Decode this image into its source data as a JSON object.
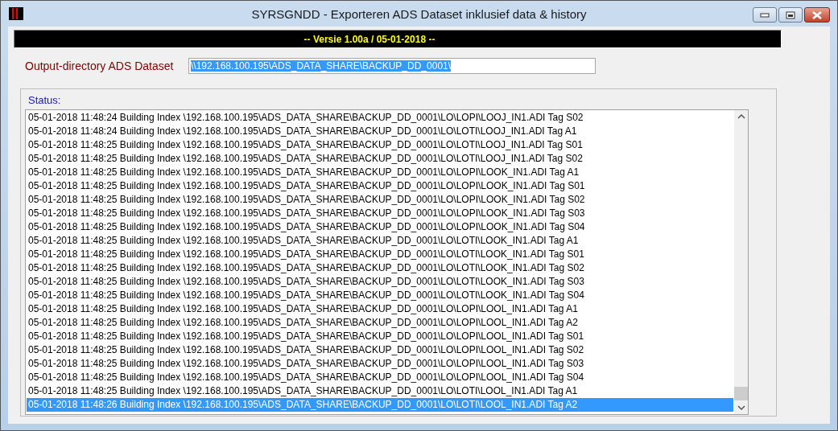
{
  "window": {
    "title": "SYRSGNDD - Exporteren ADS Dataset inklusief data & history"
  },
  "banner": {
    "text": "-- Versie 1.00a / 05-01-2018 --"
  },
  "output_directory": {
    "label": "Output-directory ADS Dataset",
    "value": "\\\\192.168.100.195\\ADS_DATA_SHARE\\BACKUP_DD_0001\\",
    "selected": true
  },
  "status": {
    "label": "Status:",
    "rows": [
      {
        "text": "05-01-2018 11:48:24 Building Index \\192.168.100.195\\ADS_DATA_SHARE\\BACKUP_DD_0001\\LO\\LOPI\\LOOJ_IN1.ADI Tag S02",
        "selected": false
      },
      {
        "text": "05-01-2018 11:48:24 Building Index \\192.168.100.195\\ADS_DATA_SHARE\\BACKUP_DD_0001\\LO\\LOTI\\LOOJ_IN1.ADI Tag A1",
        "selected": false
      },
      {
        "text": "05-01-2018 11:48:25 Building Index \\192.168.100.195\\ADS_DATA_SHARE\\BACKUP_DD_0001\\LO\\LOTI\\LOOJ_IN1.ADI Tag S01",
        "selected": false
      },
      {
        "text": "05-01-2018 11:48:25 Building Index \\192.168.100.195\\ADS_DATA_SHARE\\BACKUP_DD_0001\\LO\\LOTI\\LOOJ_IN1.ADI Tag S02",
        "selected": false
      },
      {
        "text": "05-01-2018 11:48:25 Building Index \\192.168.100.195\\ADS_DATA_SHARE\\BACKUP_DD_0001\\LO\\LOPI\\LOOK_IN1.ADI Tag A1",
        "selected": false
      },
      {
        "text": "05-01-2018 11:48:25 Building Index \\192.168.100.195\\ADS_DATA_SHARE\\BACKUP_DD_0001\\LO\\LOPI\\LOOK_IN1.ADI Tag S01",
        "selected": false
      },
      {
        "text": "05-01-2018 11:48:25 Building Index \\192.168.100.195\\ADS_DATA_SHARE\\BACKUP_DD_0001\\LO\\LOPI\\LOOK_IN1.ADI Tag S02",
        "selected": false
      },
      {
        "text": "05-01-2018 11:48:25 Building Index \\192.168.100.195\\ADS_DATA_SHARE\\BACKUP_DD_0001\\LO\\LOPI\\LOOK_IN1.ADI Tag S03",
        "selected": false
      },
      {
        "text": "05-01-2018 11:48:25 Building Index \\192.168.100.195\\ADS_DATA_SHARE\\BACKUP_DD_0001\\LO\\LOPI\\LOOK_IN1.ADI Tag S04",
        "selected": false
      },
      {
        "text": "05-01-2018 11:48:25 Building Index \\192.168.100.195\\ADS_DATA_SHARE\\BACKUP_DD_0001\\LO\\LOTI\\LOOK_IN1.ADI Tag A1",
        "selected": false
      },
      {
        "text": "05-01-2018 11:48:25 Building Index \\192.168.100.195\\ADS_DATA_SHARE\\BACKUP_DD_0001\\LO\\LOTI\\LOOK_IN1.ADI Tag S01",
        "selected": false
      },
      {
        "text": "05-01-2018 11:48:25 Building Index \\192.168.100.195\\ADS_DATA_SHARE\\BACKUP_DD_0001\\LO\\LOTI\\LOOK_IN1.ADI Tag S02",
        "selected": false
      },
      {
        "text": "05-01-2018 11:48:25 Building Index \\192.168.100.195\\ADS_DATA_SHARE\\BACKUP_DD_0001\\LO\\LOTI\\LOOK_IN1.ADI Tag S03",
        "selected": false
      },
      {
        "text": "05-01-2018 11:48:25 Building Index \\192.168.100.195\\ADS_DATA_SHARE\\BACKUP_DD_0001\\LO\\LOTI\\LOOK_IN1.ADI Tag S04",
        "selected": false
      },
      {
        "text": "05-01-2018 11:48:25 Building Index \\192.168.100.195\\ADS_DATA_SHARE\\BACKUP_DD_0001\\LO\\LOPI\\LOOL_IN1.ADI Tag A1",
        "selected": false
      },
      {
        "text": "05-01-2018 11:48:25 Building Index \\192.168.100.195\\ADS_DATA_SHARE\\BACKUP_DD_0001\\LO\\LOPI\\LOOL_IN1.ADI Tag A2",
        "selected": false
      },
      {
        "text": "05-01-2018 11:48:25 Building Index \\192.168.100.195\\ADS_DATA_SHARE\\BACKUP_DD_0001\\LO\\LOPI\\LOOL_IN1.ADI Tag S01",
        "selected": false
      },
      {
        "text": "05-01-2018 11:48:25 Building Index \\192.168.100.195\\ADS_DATA_SHARE\\BACKUP_DD_0001\\LO\\LOPI\\LOOL_IN1.ADI Tag S02",
        "selected": false
      },
      {
        "text": "05-01-2018 11:48:25 Building Index \\192.168.100.195\\ADS_DATA_SHARE\\BACKUP_DD_0001\\LO\\LOPI\\LOOL_IN1.ADI Tag S03",
        "selected": false
      },
      {
        "text": "05-01-2018 11:48:25 Building Index \\192.168.100.195\\ADS_DATA_SHARE\\BACKUP_DD_0001\\LO\\LOPI\\LOOL_IN1.ADI Tag S04",
        "selected": false
      },
      {
        "text": "05-01-2018 11:48:25 Building Index \\192.168.100.195\\ADS_DATA_SHARE\\BACKUP_DD_0001\\LO\\LOTI\\LOOL_IN1.ADI Tag A1",
        "selected": false
      },
      {
        "text": "05-01-2018 11:48:26 Building Index \\192.168.100.195\\ADS_DATA_SHARE\\BACKUP_DD_0001\\LO\\LOTI\\LOOL_IN1.ADI Tag A2",
        "selected": true
      }
    ]
  }
}
